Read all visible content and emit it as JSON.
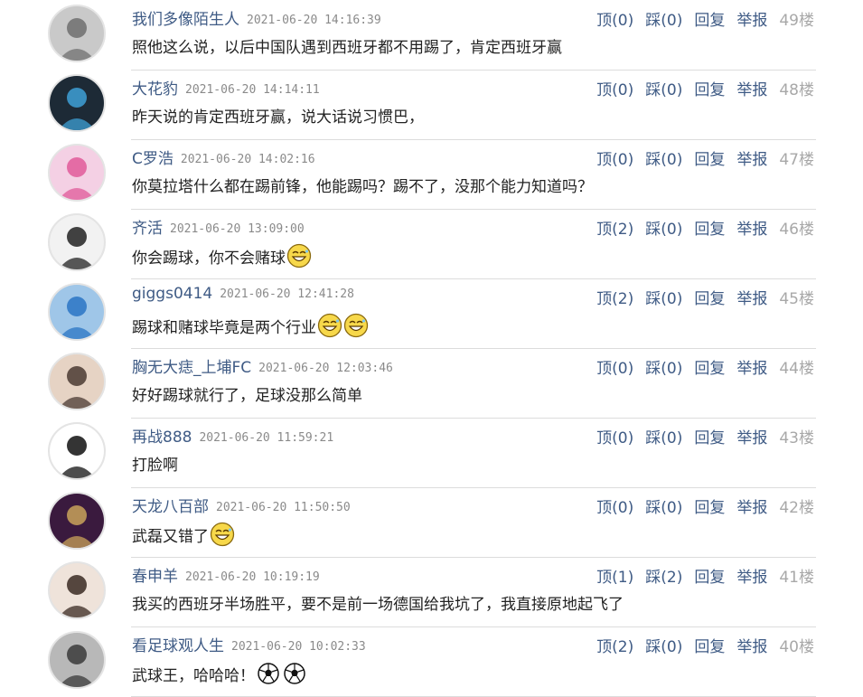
{
  "comments": [
    {
      "user": "我们多像陌生人",
      "time": "2021-06-20 14:16:39",
      "text": "照他这么说，以后中国队遇到西班牙都不用踢了，肯定西班牙赢",
      "up": "顶(0)",
      "down": "踩(0)",
      "reply": "回复",
      "report": "举报",
      "floor": "49楼",
      "emojis": [],
      "avatar_colors": [
        "#c9c9c9",
        "#6f6f6f"
      ]
    },
    {
      "user": "大花豹",
      "time": "2021-06-20 14:14:11",
      "text": "昨天说的肯定西班牙赢，说大话说习惯巴，",
      "up": "顶(0)",
      "down": "踩(0)",
      "reply": "回复",
      "report": "举报",
      "floor": "48楼",
      "emojis": [],
      "avatar_colors": [
        "#1d2a36",
        "#3ea0d6"
      ]
    },
    {
      "user": "C罗浩",
      "time": "2021-06-20 14:02:16",
      "text": "你莫拉塔什么都在踢前锋，他能踢吗？踢不了，没那个能力知道吗？",
      "up": "顶(0)",
      "down": "踩(0)",
      "reply": "回复",
      "report": "举报",
      "floor": "47楼",
      "emojis": [],
      "avatar_colors": [
        "#f4d0e4",
        "#e05a9a"
      ]
    },
    {
      "user": "齐活",
      "time": "2021-06-20 13:09:00",
      "text": "你会踢球，你不会赌球",
      "up": "顶(2)",
      "down": "踩(0)",
      "reply": "回复",
      "report": "举报",
      "floor": "46楼",
      "emojis": [
        "laugh"
      ],
      "avatar_colors": [
        "#f2f2f2",
        "#222222"
      ]
    },
    {
      "user": "giggs0414",
      "time": "2021-06-20 12:41:28",
      "text": "踢球和赌球毕竟是两个行业",
      "up": "顶(2)",
      "down": "踩(0)",
      "reply": "回复",
      "report": "举报",
      "floor": "45楼",
      "emojis": [
        "laugh",
        "laugh"
      ],
      "avatar_colors": [
        "#9fc6e8",
        "#2a74c4"
      ]
    },
    {
      "user": "胸无大痣_上埔FC",
      "time": "2021-06-20 12:03:46",
      "text": "好好踢球就行了，足球没那么简单",
      "up": "顶(0)",
      "down": "踩(0)",
      "reply": "回复",
      "report": "举报",
      "floor": "44楼",
      "emojis": [],
      "avatar_colors": [
        "#e6d3c4",
        "#4a3a33"
      ]
    },
    {
      "user": "再战888",
      "time": "2021-06-20 11:59:21",
      "text": "打脸啊",
      "up": "顶(0)",
      "down": "踩(0)",
      "reply": "回复",
      "report": "举报",
      "floor": "43楼",
      "emojis": [],
      "avatar_colors": [
        "#ffffff",
        "#111111"
      ]
    },
    {
      "user": "天龙八百部",
      "time": "2021-06-20 11:50:50",
      "text": "武磊又错了",
      "up": "顶(0)",
      "down": "踩(0)",
      "reply": "回复",
      "report": "举报",
      "floor": "42楼",
      "emojis": [
        "laugh"
      ],
      "avatar_colors": [
        "#3a1a3e",
        "#c9a35a"
      ]
    },
    {
      "user": "春申羊",
      "time": "2021-06-20 10:19:19",
      "text": "我买的西班牙半场胜平，要不是前一场德国给我坑了，我直接原地起飞了",
      "up": "顶(1)",
      "down": "踩(2)",
      "reply": "回复",
      "report": "举报",
      "floor": "41楼",
      "emojis": [],
      "avatar_colors": [
        "#efe3da",
        "#3a2a22"
      ]
    },
    {
      "user": "看足球观人生",
      "time": "2021-06-20 10:02:33",
      "text": "武球王，哈哈哈！",
      "up": "顶(2)",
      "down": "踩(0)",
      "reply": "回复",
      "report": "举报",
      "floor": "40楼",
      "emojis": [
        "soccer",
        "soccer"
      ],
      "avatar_colors": [
        "#b8b8b8",
        "#3a3a3a"
      ]
    }
  ]
}
